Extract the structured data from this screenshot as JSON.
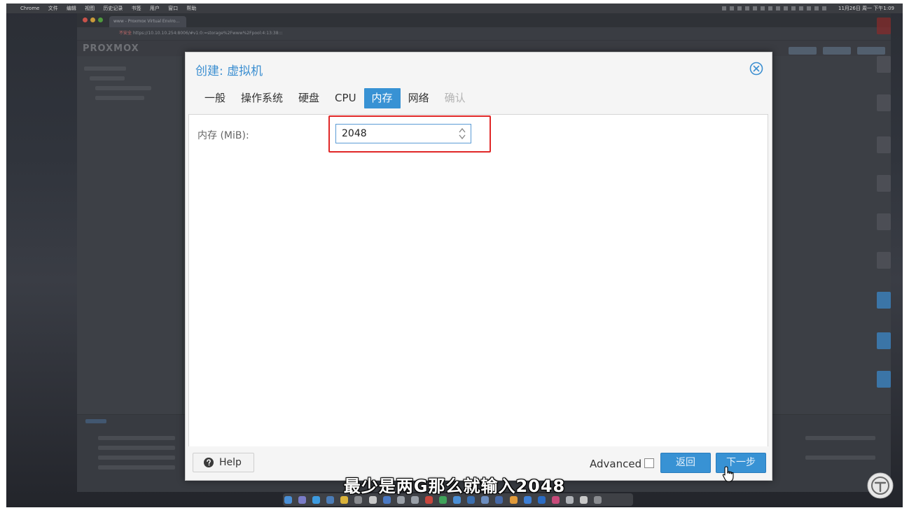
{
  "menubar": {
    "items": [
      "Chrome",
      "文件",
      "编辑",
      "视图",
      "历史记录",
      "书签",
      "用户",
      "窗口",
      "帮助"
    ],
    "clock": "11月26日 周一 下午1:09"
  },
  "browser": {
    "tab_title": "www - Proxmox Virtual Enviro...",
    "url_warning": "不安全",
    "url": "https://10.10.10.254:8006/#v1:0:=storage%2Fwww%2Fpool:4:13:38:::",
    "app_logo": "PROXMOX"
  },
  "dialog": {
    "title": "创建: 虚拟机",
    "tabs": [
      {
        "label": "一般",
        "state": "normal"
      },
      {
        "label": "操作系统",
        "state": "normal"
      },
      {
        "label": "硬盘",
        "state": "normal"
      },
      {
        "label": "CPU",
        "state": "normal"
      },
      {
        "label": "内存",
        "state": "active"
      },
      {
        "label": "网络",
        "state": "normal"
      },
      {
        "label": "确认",
        "state": "disabled"
      }
    ],
    "memory": {
      "label": "内存 (MiB):",
      "value": "2048"
    },
    "footer": {
      "help_label": "Help",
      "advanced_label": "Advanced",
      "advanced_checked": false,
      "back_label": "返回",
      "next_label": "下一步"
    }
  },
  "subtitle": "最少是两G那么就输入2048",
  "colors": {
    "accent": "#3892d4",
    "title": "#3c8fd1",
    "highlight_box": "#e02727",
    "disabled_tab": "#b3b3b3"
  },
  "icons": {
    "close": "close-circle-icon",
    "help": "question-circle-icon",
    "spinner": "up-down-chevron-icon",
    "cursor": "hand-pointer-icon"
  }
}
